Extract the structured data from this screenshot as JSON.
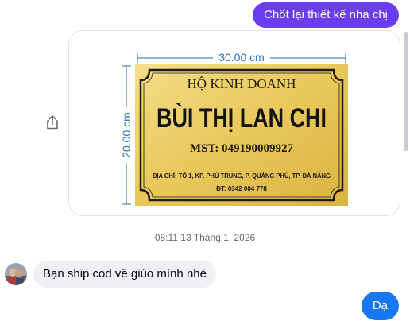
{
  "messages": {
    "outgoing_1": "Chốt lại thiết kế nha chị",
    "incoming_1": "Bạn ship cod về giúo mình nhé",
    "outgoing_2": "Dạ"
  },
  "timestamp": "08:11 13 Tháng 1, 2026",
  "design": {
    "width_label": "30.00 cm",
    "height_label": "20.00 cm",
    "line1": "HỘ KINH DOANH",
    "name": "BÙI THỊ LAN CHI",
    "tax_id": "MST: 049190009927",
    "address": "ĐỊA CHỈ: TỔ 1, KP. PHÚ TRUNG, P. QUẢNG PHÚ, TP. ĐÀ NẴNG",
    "phone": "ĐT: 0342 004 778"
  },
  "colors": {
    "outgoing_bubble": "#6a3df0",
    "outgoing_bubble_2": "#1877f2",
    "incoming_bubble": "#eef0f3",
    "sign_gold": "#e7c85b",
    "dimension_line": "#2a6fb0"
  },
  "icons": {
    "share": "share-icon",
    "avatar": "avatar"
  }
}
